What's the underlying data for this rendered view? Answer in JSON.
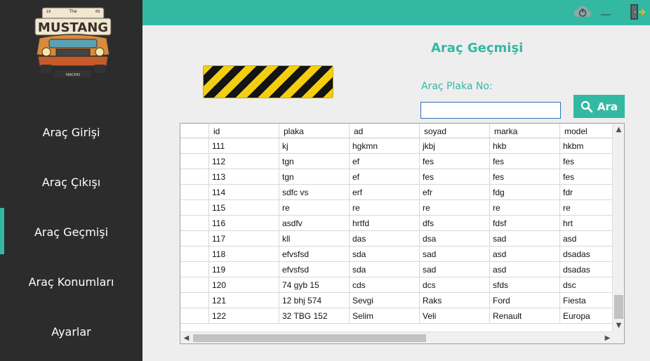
{
  "colors": {
    "accent": "#33b9a3",
    "sidebar": "#2c2c2c",
    "background": "#eeeeee"
  },
  "logo": {
    "small_text": "The",
    "brand": "MUSTANG",
    "sub": "NACHO",
    "year_left": "19",
    "year_right": "69"
  },
  "sidebar": {
    "items": [
      {
        "label": "Araç Girişi",
        "active": false
      },
      {
        "label": "Araç Çıkışı",
        "active": false
      },
      {
        "label": "Araç Geçmişi",
        "active": true
      },
      {
        "label": "Araç Konumları",
        "active": false
      },
      {
        "label": "Ayarlar",
        "active": false
      }
    ]
  },
  "topbar": {
    "icons": [
      "power-icon",
      "minimize-icon",
      "exit-door-icon"
    ],
    "minimize_glyph": "__"
  },
  "main": {
    "title": "Araç Geçmişi",
    "plate_label": "Araç Plaka No:",
    "plate_value": "",
    "search_label": "Ara"
  },
  "table": {
    "columns": [
      "id",
      "plaka",
      "ad",
      "soyad",
      "marka",
      "model"
    ],
    "rows": [
      [
        "111",
        "kj",
        "hgkmn",
        "jkbj",
        "hkb",
        "hkbm"
      ],
      [
        "112",
        "tgn",
        "ef",
        "fes",
        "fes",
        "fes"
      ],
      [
        "113",
        "tgn",
        "ef",
        "fes",
        "fes",
        "fes"
      ],
      [
        "114",
        "sdfc vs",
        "erf",
        "efr",
        "fdg",
        "fdr"
      ],
      [
        "115",
        "re",
        "re",
        "re",
        "re",
        "re"
      ],
      [
        "116",
        "asdfv",
        "hrtfd",
        "dfs",
        "fdsf",
        "hrt"
      ],
      [
        "117",
        "kll",
        "das",
        "dsa",
        "sad",
        "asd"
      ],
      [
        "118",
        "efvsfsd",
        "sda",
        "sad",
        "asd",
        "dsadas"
      ],
      [
        "119",
        "efvsfsd",
        "sda",
        "sad",
        "asd",
        "dsadas"
      ],
      [
        "120",
        "74 gyb 15",
        "cds",
        "dcs",
        "sfds",
        "dsc"
      ],
      [
        "121",
        "12 bhj 574",
        "Sevgi",
        "Raks",
        "Ford",
        "Fiesta"
      ],
      [
        "122",
        "32 TBG 152",
        "Selim",
        "Veli",
        "Renault",
        "Europa"
      ]
    ]
  }
}
